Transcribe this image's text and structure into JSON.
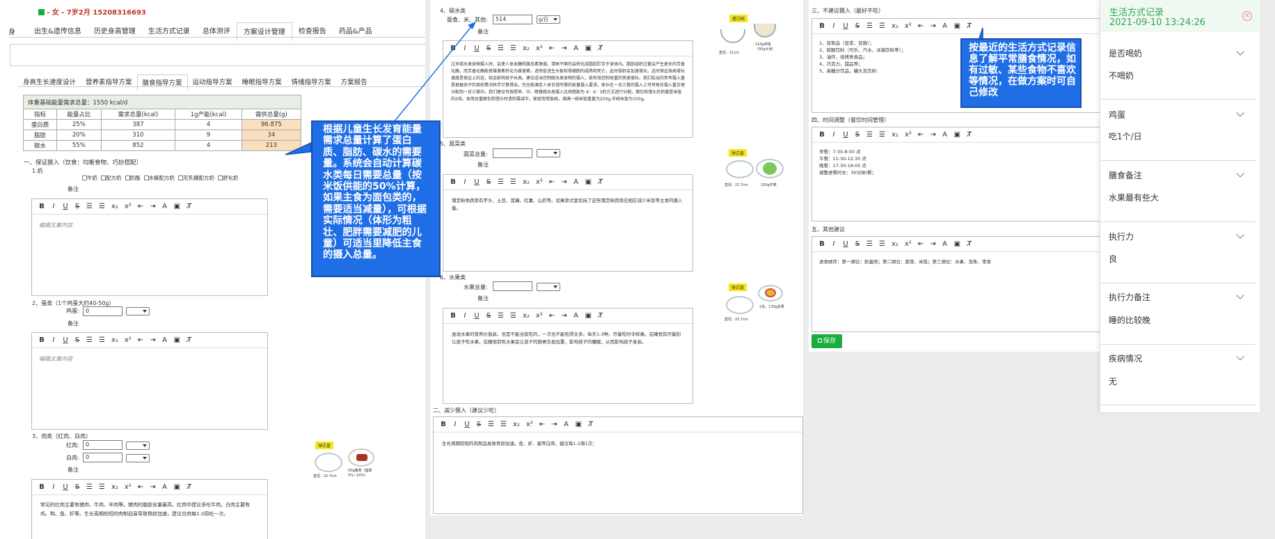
{
  "left": {
    "patient": "- 女 - 7岁2月 15208316693",
    "nav_cut": "身",
    "top_tabs": [
      "出生&遗传信息",
      "历史身高管理",
      "生活方式记录",
      "总体测评",
      "方案设计管理",
      "检查报告",
      "药品&产品"
    ],
    "sub_tabs": [
      "身高生长速度设计",
      "营养素指导方案",
      "膳食指导方案",
      "运动指导方案",
      "睡眠指导方案",
      "情绪指导方案",
      "方案报告"
    ],
    "energy_title": "体重基础能量需求总量：1550 kcal/d",
    "table_head": [
      "指标",
      "能量占比",
      "需求总量(kcal)",
      "1g产能(kcal)",
      "需供总量(g)"
    ],
    "table_rows": [
      [
        "蛋白质",
        "25%",
        "387",
        "4",
        "96.875"
      ],
      [
        "脂肪",
        "20%",
        "310",
        "9",
        "34"
      ],
      [
        "碳水",
        "55%",
        "852",
        "4",
        "213"
      ]
    ],
    "sec_ensure": "一、保证摄入（饮食：均衡食物、巧妙搭配）",
    "milk_title": "1.奶",
    "milk_options": [
      "牛奶",
      "配方奶",
      "奶酪",
      "水解配方奶",
      "无乳糖配方奶",
      "舒化奶"
    ],
    "remark": "备注",
    "editor_placeholder": "编辑文章内容",
    "egg_title": "2、蛋类（1个鸡蛋大约40-50g）",
    "egg_label": "鸡蛋:",
    "egg_value": "0",
    "meat_title": "3、肉类（红肉、白肉）",
    "red_label": "红肉:",
    "red_value": "0",
    "white_label": "白肉:",
    "white_value": "0",
    "meat_text": "常见的红肉主要有猪肉、牛肉、羊肉等。猪肉的脂肪含量最高。红肉中建议多吃牛肉。白肉主要有鸡、鸭、鱼、虾等。生长周期较短的肉制品易导致骨龄加速，建议白肉每1-2周吃一次。",
    "meat_img_tag": "弹式盘",
    "meat_img_cap1": "直径：22.7cm",
    "meat_img_cap2": "50g瘦肉（脂肪5%~10%）"
  },
  "toolbar": {
    "bold": "B",
    "italic": "I",
    "underline": "U",
    "strike": "S",
    "ol": "☰",
    "ul": "☰",
    "sub": "x₂",
    "sup": "x²",
    "indent_l": "⇤",
    "indent_r": "⇥",
    "color": "A",
    "bg": "▣",
    "clear": "T̸"
  },
  "callout_left": "根据儿童生长发育能量需求总量计算了蛋白质、脂肪、碳水的需要量。系统会自动计算碳水类每日需要总量（按米饭供能的50%计算，如果主食为面包类的，需要适当减量），可根据实际情况（体形为粗壮、肥胖需要减肥的儿童）可适当里降低主食的摄入总量。",
  "middle": {
    "carb_title": "4、碳水类",
    "carb_label": "面食、米、其他:",
    "carb_value": "514",
    "carb_unit": "g/日",
    "remark": "备注",
    "carb_text": "过多碳水类食物摄入时，会使人体血糖和胰岛素激增。清晰不够的会转化成脂肪贮存于身体内。脂肪组织过量会产生更多的芳香化酶，而芳香化酶能使雄激素转化为雌激素。进而促进生长板软骨细胞的成熟和死亡，此时骨龄会加速增长。这时保证身高增长速度是保证上的话，就会影响孩子长高。建议适当控制碳水类食物的摄入，能有效控制体重的快速增长。我们给出的参考摄入量是根据孩子的目前情况科学计算得出，完全能满足人体日常所需的能量摄入要求。家长在一日三餐的摄入上可将每日摄入量合理分配到一日三餐中。我们建议可按照早、中、晚餐碳水类摄入比例搭配为 4：4：3的方式进行分配。面包和馒头的热量是米饭的2倍。食用总量面包和馒头时请的摄减半，家庭常用饭碗，满满一碗米饭重量为250g,半碗米饭为100g。",
    "carb_img_tag": "盛口碗",
    "carb_img_cap1": "直径：11cm",
    "carb_img_cap2": "110g米饭（50g大米）",
    "veg_title": "5、蔬菜类",
    "veg_label": "蔬菜总量:",
    "veg_text": "蒲定粉类蔬菜有芋头、土豆、莲藕、红薯、山药等。如果菜式里包括了这些蒲定粉蔬菜应相应减少米饭等主食的摄入量。",
    "veg_img_tag": "弹式盘",
    "veg_img_cap1": "直径：22.7cm",
    "veg_img_cap2": "100g芹菜",
    "fruit_title": "6、水果类",
    "fruit_label": "水果总量:",
    "fruit_text": "虽说水果的营养价值高，也是不能当饭吃的，一次也不能吃得太多。每天1-3种，尽量吃时令鲜果。在睡觉前尽量别让孩子吃水果，在睡觉前吃水果会让孩子的肠胃负担加重，影响孩子的睡眠，从而影响孩子身高。",
    "fruit_img_tag": "弹式盘",
    "fruit_img_cap1": "直径：22.7cm",
    "fruit_img_cap2": "1份，130g去果",
    "reduce_title": "二、减少摄入（建议少吃）",
    "reduce_text": "生长周期较短的肉制品易致骨龄加速。鱼、虾、蛋等白肉，建议每1-2周1次："
  },
  "right": {
    "nosugg_title": "三、不建议摄入（最好不吃）",
    "nosugg_text": "1、豆制品（豆浆、豆腐）；\n2、碳酸饮料（可乐、汽水、冰镇饮料等）；\n3、油炸、烧烤类食品；\n4、巧克力、甜品等；\n5、高糖分饮品，罐头及饮料：",
    "time_title": "四、时间调整（餐饮时间管理）",
    "time_text": "早餐：7:30-8:00 点\n午餐：11:30-12:30 点\n晚餐：17:30-18:00 点\n调整进餐时长：30分钟/餐；",
    "other_title": "五、其他建议",
    "other_text": "进食顺序：第一顺位：奶蛋肉；第二顺位：蔬菜、米饭；第三顺位：水果、泡条、零食",
    "save_label": "保存"
  },
  "callout_right": "按最近的生活方式记录信息了解平常膳食情况，如有过敏、某些食物不喜欢等情况，在做方案时可自己修改",
  "drawer": {
    "title": "生活方式记录",
    "datetime": "2021-09-10 13:24:26",
    "items": [
      {
        "label": "是否喝奶",
        "value": "不喝奶"
      },
      {
        "label": "鸡蛋",
        "value": "吃1个/日"
      },
      {
        "label": "膳食备注",
        "value": "水果最有些大"
      },
      {
        "label": "执行力",
        "value": "良"
      },
      {
        "label": "执行力备注",
        "value": "睡的比较晚"
      },
      {
        "label": "疾病情况",
        "value": "无"
      }
    ]
  },
  "colors": {
    "green": "#1aad3e",
    "callout": "#1f6ee6",
    "header_green": "#2fa84f",
    "highlight": "#f9dfbe"
  }
}
